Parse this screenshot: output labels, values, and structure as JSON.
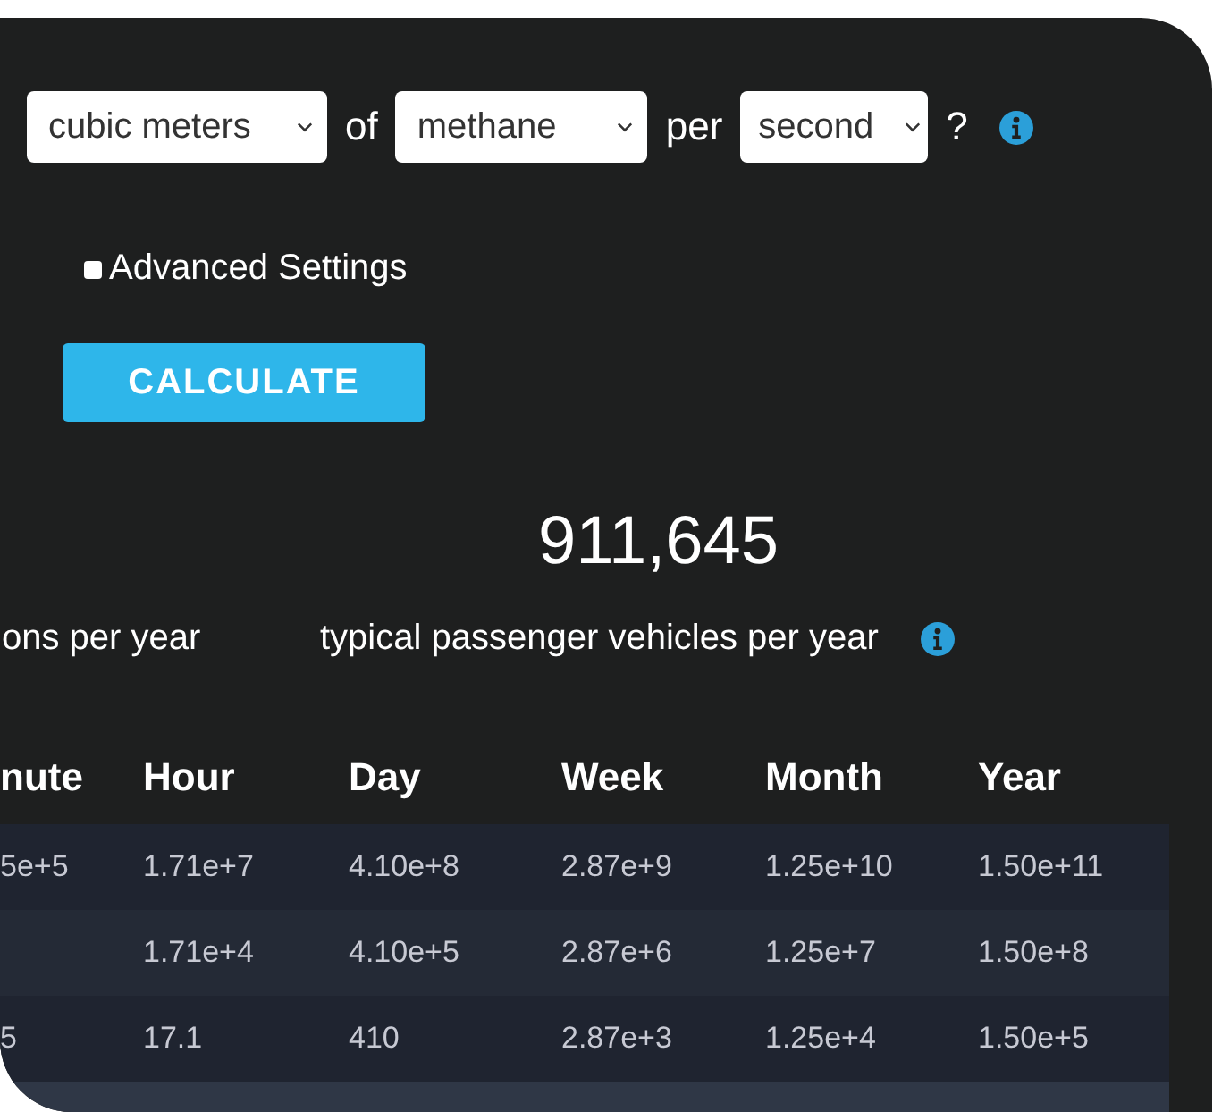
{
  "query": {
    "unit": "cubic meters",
    "of_label": "of",
    "gas": "methane",
    "per_label": "per",
    "period": "second",
    "question_mark": "?"
  },
  "advanced_settings": {
    "label": "Advanced Settings",
    "checked": false
  },
  "calculate_button": "CALCULATE",
  "results": [
    {
      "label": "ons per year",
      "info": false
    },
    {
      "value": "911,645",
      "label": "typical passenger vehicles per year",
      "info": true
    }
  ],
  "table": {
    "columns": [
      "nute",
      "Hour",
      "Day",
      "Week",
      "Month",
      "Year"
    ],
    "rows": [
      [
        "5e+5",
        "1.71e+7",
        "4.10e+8",
        "2.87e+9",
        "1.25e+10",
        "1.50e+11"
      ],
      [
        "",
        "1.71e+4",
        "4.10e+5",
        "2.87e+6",
        "1.25e+7",
        "1.50e+8"
      ],
      [
        "5",
        "17.1",
        "410",
        "2.87e+3",
        "1.25e+4",
        "1.50e+5"
      ]
    ]
  }
}
